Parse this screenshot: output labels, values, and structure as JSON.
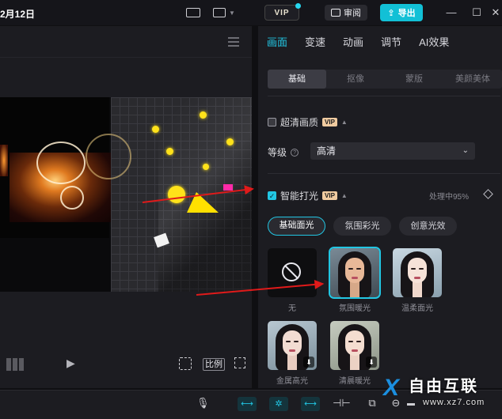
{
  "titlebar": {
    "date": "2月12日",
    "vip_label": "VIP",
    "review_label": "审阅",
    "export_label": "导出",
    "keyboard_icon": "keyboard-icon",
    "layout_icon": "layout-icon",
    "minimize": "—",
    "maximize": "☐",
    "close": "✕"
  },
  "player": {
    "ratio_label": "比例"
  },
  "panel": {
    "tabs": [
      {
        "label": "画面",
        "active": true
      },
      {
        "label": "变速"
      },
      {
        "label": "动画"
      },
      {
        "label": "调节"
      },
      {
        "label": "AI效果"
      }
    ],
    "subtabs": [
      {
        "label": "基础",
        "active": true
      },
      {
        "label": "抠像"
      },
      {
        "label": "蒙版"
      },
      {
        "label": "美颜美体"
      }
    ],
    "hd": {
      "label": "超清画质",
      "vip": "VIP",
      "checked": false
    },
    "level": {
      "label": "等级",
      "value": "高清"
    },
    "lighting": {
      "label": "智能打光",
      "vip": "VIP",
      "checked": true,
      "status": "处理中95%"
    },
    "light_modes": [
      {
        "label": "基础面光",
        "active": true
      },
      {
        "label": "氛围彩光"
      },
      {
        "label": "创意光效"
      }
    ],
    "presets": [
      {
        "label": "无"
      },
      {
        "label": "氛围暖光",
        "active": true
      },
      {
        "label": "温柔面光"
      },
      {
        "label": "金属高光"
      },
      {
        "label": "清晨暖光"
      }
    ]
  },
  "watermark": {
    "text": "自由互联",
    "sub": "www.xz7.com"
  },
  "colors": {
    "accent": "#22c6e3",
    "arrow": "#e01a1a",
    "vip_tag": "#f0cba0"
  }
}
